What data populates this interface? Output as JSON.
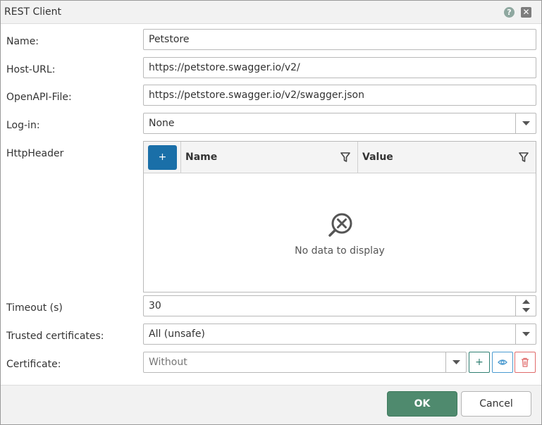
{
  "window": {
    "title": "REST Client"
  },
  "form": {
    "name": {
      "label": "Name:",
      "value": "Petstore"
    },
    "host_url": {
      "label": "Host-URL:",
      "value": "https://petstore.swagger.io/v2/"
    },
    "openapi_file": {
      "label": "OpenAPI-File:",
      "value": "https://petstore.swagger.io/v2/swagger.json"
    },
    "login": {
      "label": "Log-in:",
      "value": "None"
    },
    "http_header": {
      "label": "HttpHeader",
      "add_label": "+",
      "columns": [
        "Name",
        "Value"
      ],
      "empty_text": "No data to display"
    },
    "timeout": {
      "label": "Timeout (s)",
      "value": "30"
    },
    "trusted_certificates": {
      "label": "Trusted certificates:",
      "value": "All (unsafe)"
    },
    "certificate": {
      "label": "Certificate:",
      "value": "Without",
      "add_label": "+"
    }
  },
  "footer": {
    "ok_label": "OK",
    "cancel_label": "Cancel"
  },
  "colors": {
    "primary_blue": "#1a6fa8",
    "ok_green": "#4f8a6e",
    "add_teal": "#2f7f72",
    "view_blue": "#4a9ad0",
    "delete_red": "#e06a6a"
  }
}
